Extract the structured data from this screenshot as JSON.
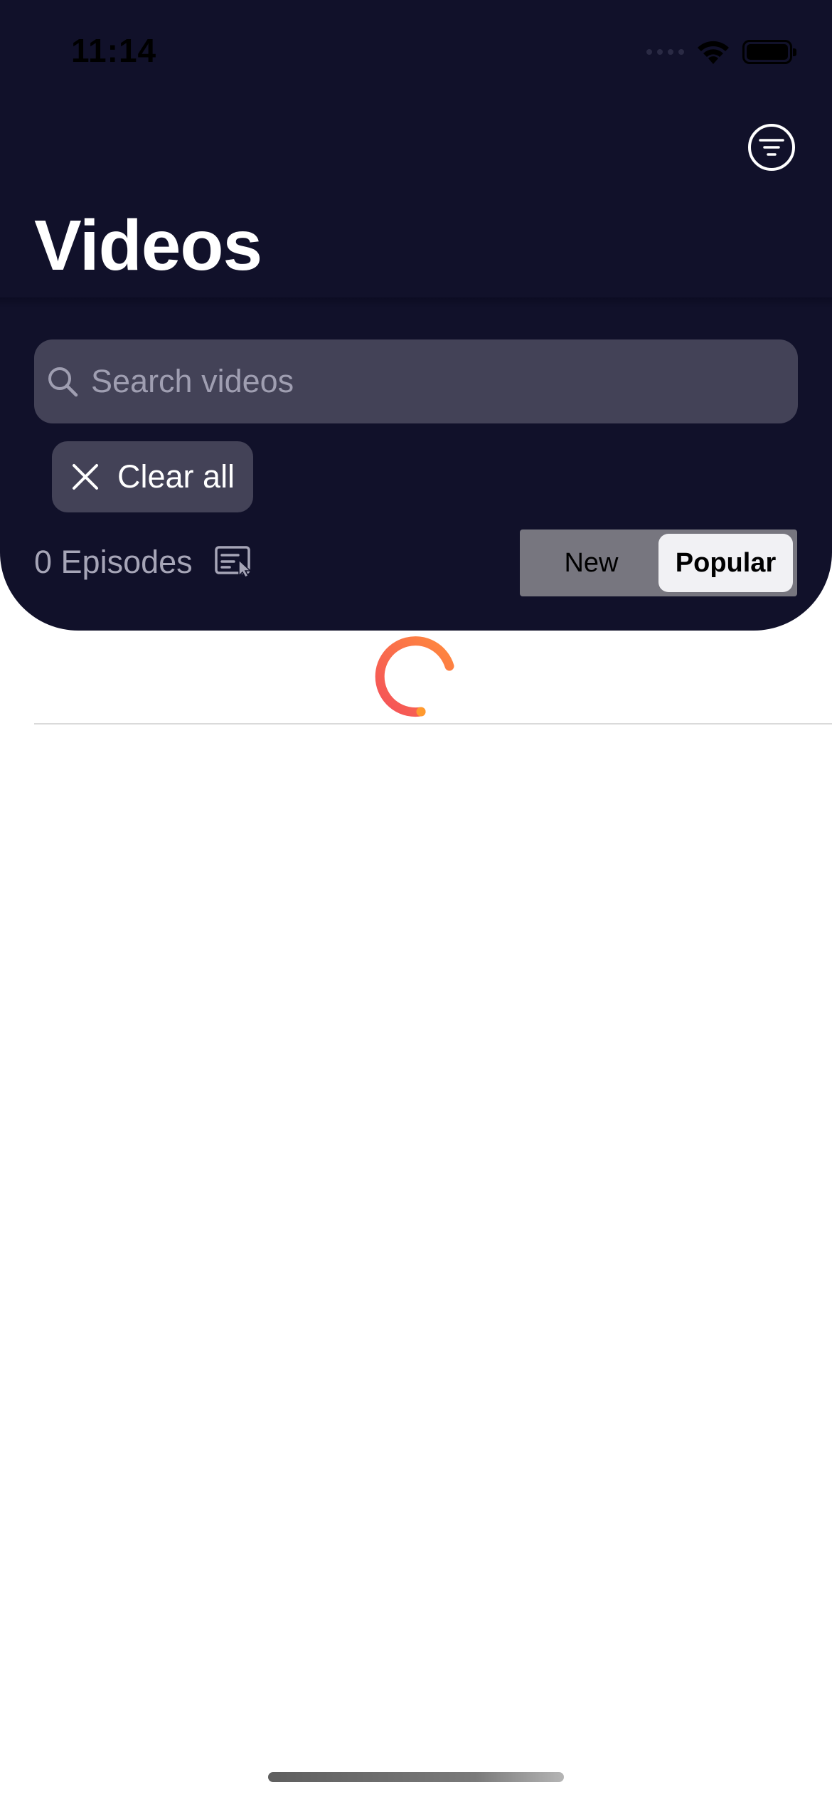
{
  "status_bar": {
    "time": "11:14"
  },
  "header": {
    "title": "Videos",
    "filter_icon": "filter-lines-icon"
  },
  "search": {
    "placeholder": "Search videos",
    "icon": "search-icon"
  },
  "filters": {
    "clear_all_label": "Clear all",
    "clear_icon": "close-icon"
  },
  "episodes": {
    "count_label": "0 Episodes",
    "icon": "list-select-icon"
  },
  "sort": {
    "options": [
      "New",
      "Popular"
    ],
    "selected": "Popular"
  },
  "loading": {
    "icon": "loading-spinner-icon"
  },
  "colors": {
    "header_bg": "#11112a",
    "search_bg": "#434257",
    "spinner_start": "#f4505a",
    "spinner_end": "#ff8a3d"
  }
}
